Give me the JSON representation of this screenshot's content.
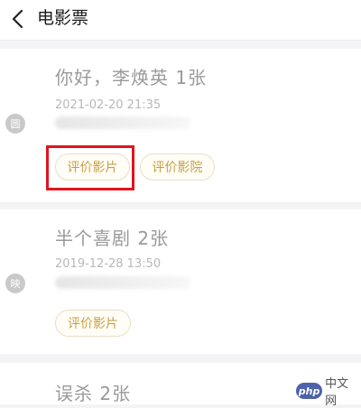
{
  "header": {
    "title": "电影票"
  },
  "orders": [
    {
      "movie": "你好，李焕英 1张",
      "time": "2021-02-20 21:35",
      "status_icon": "圆",
      "buttons": [
        "评价影片",
        "评价影院"
      ]
    },
    {
      "movie": "半个喜剧 2张",
      "time": "2019-12-28 13:50",
      "status_icon": "映",
      "buttons": [
        "评价影片"
      ]
    },
    {
      "movie": "误杀 2张"
    }
  ],
  "watermark": {
    "badge": "php",
    "text": "中文网"
  },
  "colors": {
    "accent": "#c9a040",
    "highlight": "#e1141c"
  }
}
